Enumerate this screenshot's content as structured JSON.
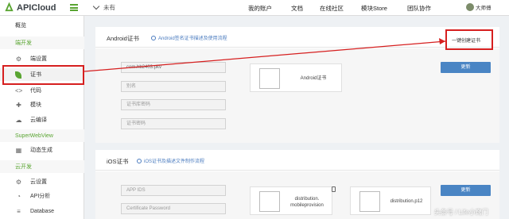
{
  "topbar": {
    "logo_text": "APICloud",
    "project": "未有",
    "nav": [
      "我的账户",
      "文档",
      "在线社区",
      "模块Store",
      "团队协作"
    ],
    "user": "大师傅"
  },
  "sidebar": {
    "overview": "概览",
    "native_section": "端开发",
    "items_native": [
      {
        "label": "端设置",
        "icon": "gear-icon"
      },
      {
        "label": "证书",
        "icon": "leaf-icon"
      },
      {
        "label": "代码",
        "icon": "code-icon"
      },
      {
        "label": "模块",
        "icon": "puzzle-icon"
      },
      {
        "label": "云编译",
        "icon": "cloud-icon"
      }
    ],
    "webview_section": "SuperWebView",
    "items_webview": [
      {
        "label": "动态生成",
        "icon": "grid-icon"
      }
    ],
    "cloud_section": "云开发",
    "items_cloud": [
      {
        "label": "云设置",
        "icon": "gear-icon"
      },
      {
        "label": "API分析",
        "icon": "chart-icon"
      },
      {
        "label": "Database",
        "icon": "database-icon"
      }
    ]
  },
  "android": {
    "title": "Android证书",
    "help_link": "Android签名证书描述及使用流程",
    "create_button": "一键创建证书",
    "fields": [
      {
        "value": "com.hb2403.pkv",
        "placeholder": ""
      },
      {
        "value": "",
        "placeholder": "别名"
      },
      {
        "value": "",
        "placeholder": "证书库密码"
      },
      {
        "value": "",
        "placeholder": "证书密码"
      }
    ],
    "cert_label": "Android证书",
    "update_button": "更新"
  },
  "ios": {
    "title": "iOS证书",
    "help_link": "iOS证书及描述文件制作流程",
    "fields": [
      {
        "value": "",
        "placeholder": "APP IDS"
      },
      {
        "value": "",
        "placeholder": "Certificate Password"
      }
    ],
    "provision_label_1": "distribution.",
    "provision_label_2": "mobileprovision",
    "p12_label": "distribution.p12",
    "update_button": "更新"
  },
  "watermark": "头条号 / Life小窍门",
  "colors": {
    "brand_green": "#5aa532",
    "link_blue": "#4a7bbf",
    "button_blue": "#4a85c4",
    "annotation_red": "#d61f1f"
  }
}
